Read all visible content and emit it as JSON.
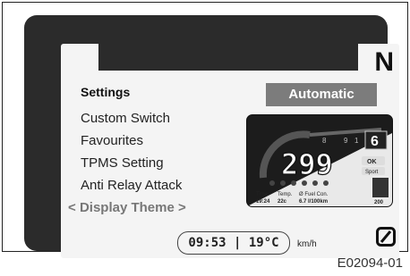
{
  "display": {
    "gear": "N",
    "mode": "Automatic",
    "menu": {
      "title": "Settings",
      "items": [
        "Custom Switch",
        "Favourites",
        "TPMS Setting",
        "Anti Relay Attack"
      ],
      "selected": "Display Theme",
      "prev_arrow": "<",
      "next_arrow": ">"
    },
    "status": {
      "time": "09:53",
      "separator": "|",
      "temperature": "19°C",
      "speed_unit": "km/h"
    },
    "preview": {
      "speed": "299",
      "gear": "6",
      "ok_label": "OK",
      "sport_label": "Sport",
      "ticks": [
        "8",
        "9",
        "1"
      ],
      "footer_labels": [
        "Time",
        "Temp.",
        "Ø Fuel Con."
      ],
      "footer_values": [
        "19:24",
        "22c",
        "6.7 l/100km"
      ],
      "odo": "200"
    },
    "no_icon_name": "no-symbol-icon"
  },
  "figure_code": "E02094-01"
}
